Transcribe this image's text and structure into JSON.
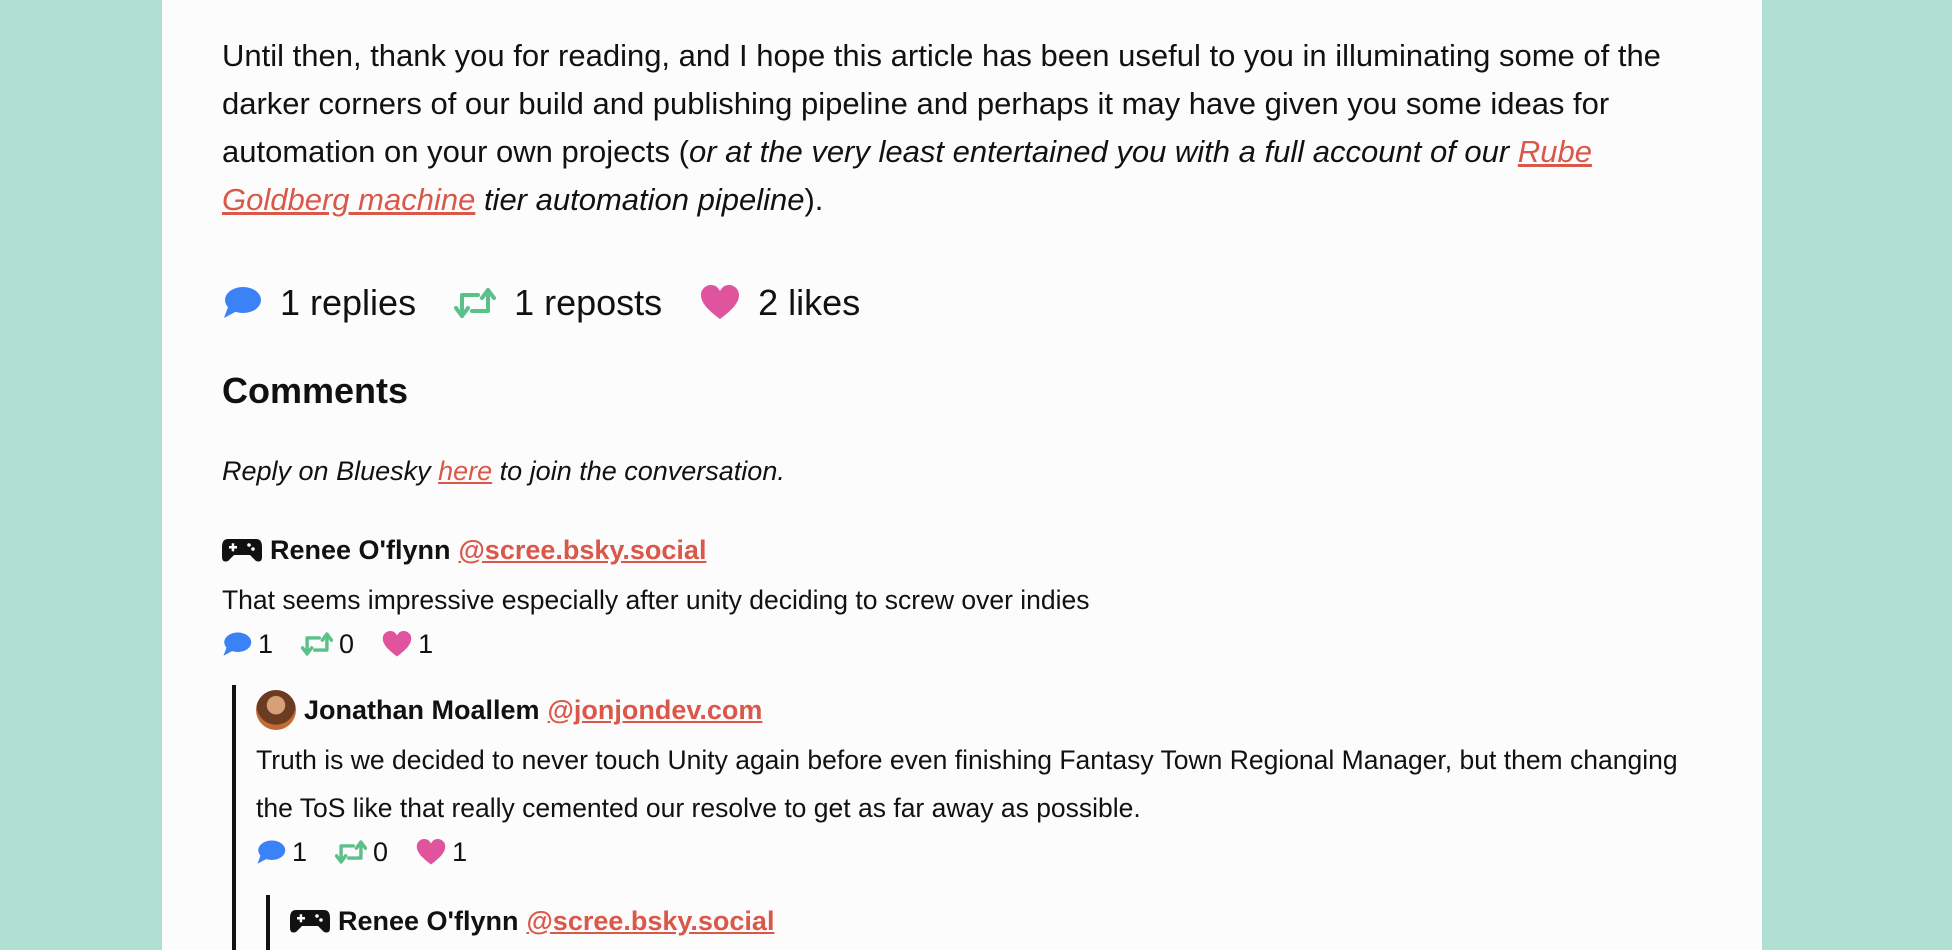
{
  "article": {
    "closing_part1": "Until then, thank you for reading, and I hope this article has been useful to you in illuminating some of the darker corners of our build and publishing pipeline and perhaps it may have given you some ideas for automation on your own projects (",
    "closing_italic1": "or at the very least entertained you with a full account of our ",
    "closing_link": "Rube Goldberg machine",
    "closing_italic2": " tier automation pipeline",
    "closing_end": ")."
  },
  "stats": {
    "replies": "1 replies",
    "reposts": "1 reposts",
    "likes": "2 likes"
  },
  "comments_section": {
    "heading": "Comments",
    "reply_prefix": "Reply on Bluesky ",
    "reply_link": "here",
    "reply_suffix": " to join the conversation."
  },
  "comments": [
    {
      "name": "Renee O'flynn",
      "handle": "@scree.bsky.social",
      "text": "That seems impressive especially after unity deciding to screw over indies",
      "replies": "1",
      "reposts": "0",
      "likes": "1"
    },
    {
      "name": "Jonathan Moallem",
      "handle": "@jonjondev.com",
      "text": "Truth is we decided to never touch Unity again before even finishing Fantasy Town Regional Manager, but them changing the ToS like that really cemented our resolve to get as far away as possible.",
      "replies": "1",
      "reposts": "0",
      "likes": "1"
    },
    {
      "name": "Renee O'flynn",
      "handle": "@scree.bsky.social"
    }
  ],
  "colors": {
    "background": "#b1dfd1",
    "link": "#d9584a",
    "reply_icon": "#3b82f6",
    "repost_icon": "#5cc08a",
    "like_icon": "#e0539d"
  }
}
